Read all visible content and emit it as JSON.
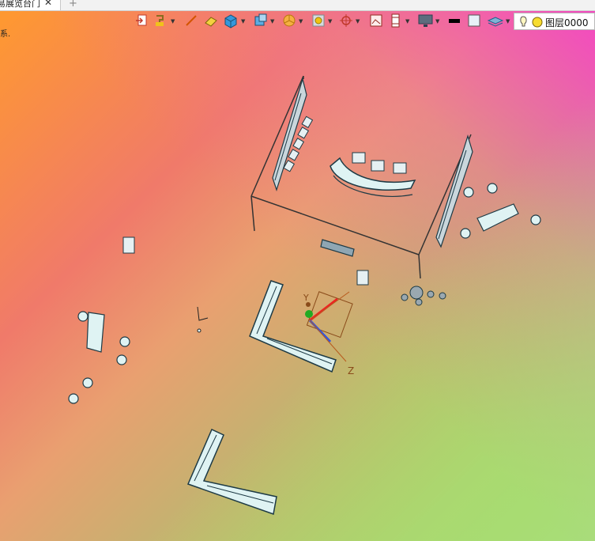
{
  "tab": {
    "label": "易展览台门",
    "close_glyph": "✕",
    "add_glyph": "+"
  },
  "corner_text": "系.",
  "toolbar": {
    "items": [
      "exit-icon",
      "paint-icon",
      "line-icon",
      "eraser-icon",
      "cube-icon",
      "view-cube-icon",
      "pie-icon",
      "frame-icon",
      "snap-icon",
      "picture-icon",
      "column-icon",
      "monitor-icon",
      "color-black-icon",
      "color-white-icon",
      "layer-stack-icon"
    ]
  },
  "layer": {
    "label": "图层0000",
    "icons": [
      "lightbulb-icon",
      "sun-icon"
    ]
  },
  "axis": {
    "y_label": "Y",
    "z_label": "Z"
  },
  "colors": {
    "gradient_orange": "#ff9a2e",
    "gradient_magenta": "#f640c8",
    "gradient_green": "#9be43a",
    "furniture_fill": "#dff3f3",
    "outline": "#1d3a45"
  }
}
